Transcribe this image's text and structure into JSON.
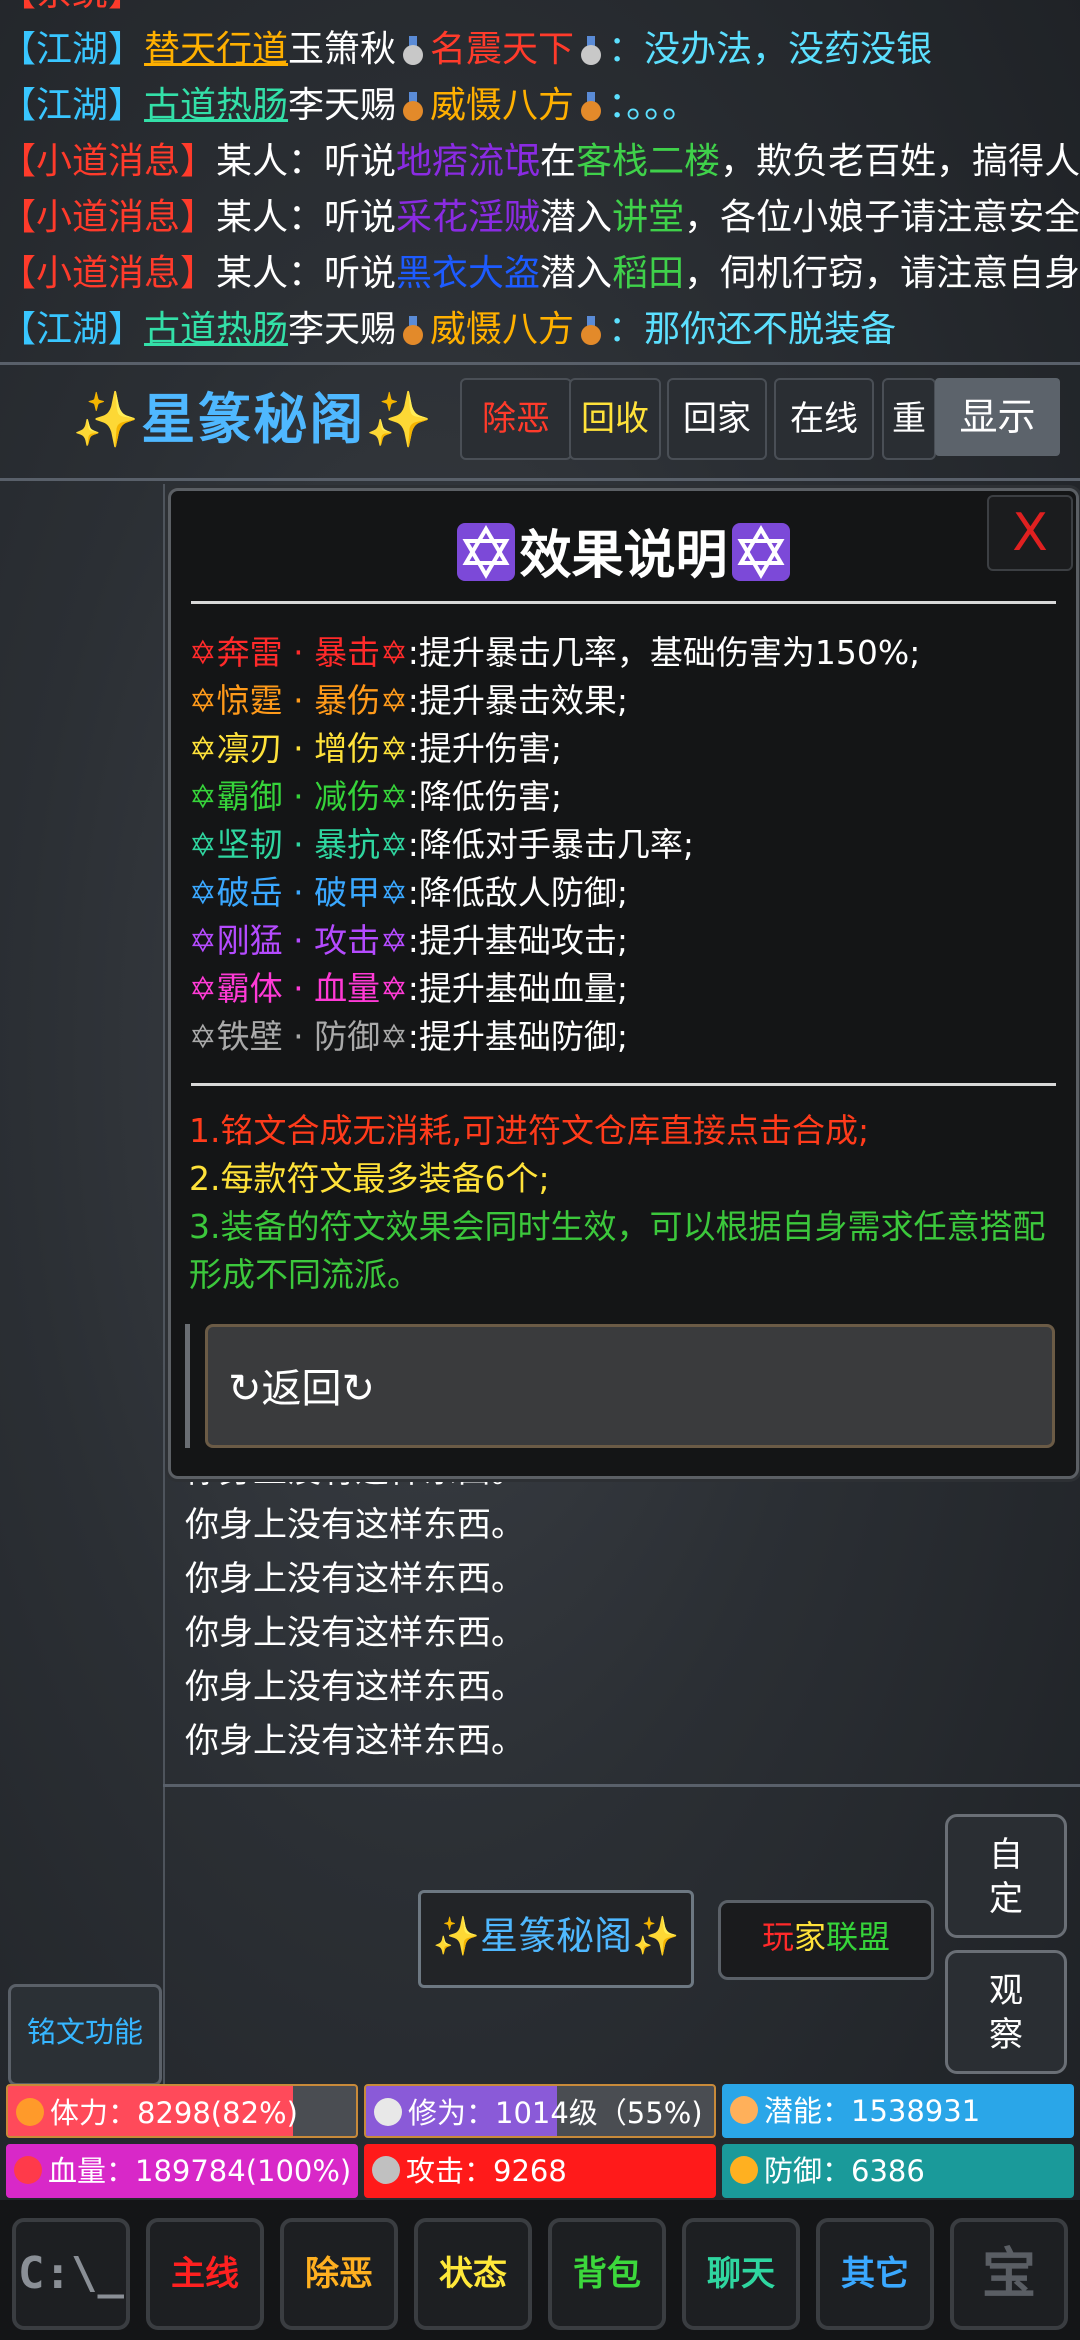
{
  "chat": {
    "lines": [
      {
        "tag": "【江湖】",
        "a": "替天行道",
        "b": "玉箫秋",
        "c": "名震天下",
        "d": "：没办法，没药没银"
      },
      {
        "tag": "【江湖】",
        "a": "古道热肠",
        "b": "李天赐",
        "c": "威慑八方",
        "d": "：。。。"
      },
      {
        "tag": "【小道消息】",
        "p1": "某人：听说",
        "n": "地痞流氓",
        "p2": "在",
        "loc": "客栈二楼",
        "p3": "，欺负老百姓，搞得人"
      },
      {
        "tag": "【小道消息】",
        "p1": "某人：听说",
        "n": "采花淫贼",
        "p2": "潜入",
        "loc": "讲堂",
        "p3": "，各位小娘子请注意安全"
      },
      {
        "tag": "【小道消息】",
        "p1": "某人：听说",
        "n": "黑衣大盗",
        "p2": "潜入",
        "loc": "稻田",
        "p3": "，伺机行窃，请注意自身"
      },
      {
        "tag": "【江湖】",
        "a": "古道热肠",
        "b": "李天赐",
        "c": "威慑八方",
        "d": "：那你还不脱装备"
      }
    ]
  },
  "header": {
    "title": "星篆秘阁",
    "tabs": [
      "除恶",
      "回收",
      "回家",
      "在线",
      "重"
    ],
    "tab_colors": [
      "#ff3b2b",
      "#ffe23a",
      "#ffffff",
      "#ffffff",
      "#ffffff"
    ],
    "show_label": "显示"
  },
  "modal": {
    "title": "效果说明",
    "close_label": "X",
    "divider": "———————————————————————————",
    "effects": [
      {
        "name": "✡奔雷 · 暴击✡",
        "desc": ":提升暴击几率，基础伤害为150%;",
        "color": "#ff2a2a"
      },
      {
        "name": "✡惊霆 · 暴伤✡",
        "desc": ":提升暴击效果;",
        "color": "#ff9a1a"
      },
      {
        "name": "✡凛刃 · 增伤✡",
        "desc": ":提升伤害;",
        "color": "#ffe23a"
      },
      {
        "name": "✡霸御 · 减伤✡",
        "desc": ":降低伤害;",
        "color": "#36d43a"
      },
      {
        "name": "✡坚韧 · 暴抗✡",
        "desc": ":降低对手暴击几率;",
        "color": "#2fd6a0"
      },
      {
        "name": "✡破岳 · 破甲✡",
        "desc": ":降低敌人防御;",
        "color": "#3aa8ff"
      },
      {
        "name": "✡刚猛 · 攻击✡",
        "desc": ":提升基础攻击;",
        "color": "#b54bff"
      },
      {
        "name": "✡霸体 · 血量✡",
        "desc": ":提升基础血量;",
        "color": "#ff3ad6"
      },
      {
        "name": "✡铁壁 · 防御✡",
        "desc": ":提升基础防御;",
        "color": "#a9a9a9"
      }
    ],
    "notes": [
      {
        "text": "1.铭文合成无消耗,可进符文仓库直接点击合成;",
        "color": "#ff3b1b"
      },
      {
        "text": "2.每款符文最多装备6个;",
        "color": "#ffe23a"
      },
      {
        "text": "3.装备的符文效果会同时生效，可以根据自身需求任意搭配形成不同流派。",
        "color": "#3cc83c"
      }
    ],
    "back_label": "↻返回↻"
  },
  "messages": [
    "你身上没有这样东西。",
    "你身上没有这样东西。",
    "你身上没有这样东西。",
    "你身上没有这样东西。",
    "你身上没有这样东西。",
    "你身上没有这样东西。"
  ],
  "side": {
    "custom_label": "自定",
    "observe_label": "观察"
  },
  "mid": {
    "star_label": "星篆秘阁",
    "league_a": "玩",
    "league_b": "家",
    "league_c": "联盟"
  },
  "inscription_label": "铭文功能",
  "stats": {
    "stamina": "体力：8298(82%)",
    "stamina_fraction": 0.82,
    "cultivation": "修为：1014级（55%)",
    "cultivation_fraction": 0.55,
    "potential": "潜能：1538931",
    "hp": "血量：189784(100%)",
    "hp_fraction": 1.0,
    "attack": "攻击：9268",
    "defense": "防御：6386"
  },
  "nav": {
    "items": [
      {
        "label": "主线",
        "color": "#ff2020"
      },
      {
        "label": "除恶",
        "color": "#ffb020"
      },
      {
        "label": "状态",
        "color": "#ffe83a"
      },
      {
        "label": "背包",
        "color": "#3cd83c"
      },
      {
        "label": "聊天",
        "color": "#2fd6a0"
      },
      {
        "label": "其它",
        "color": "#3aa8ff"
      }
    ]
  }
}
